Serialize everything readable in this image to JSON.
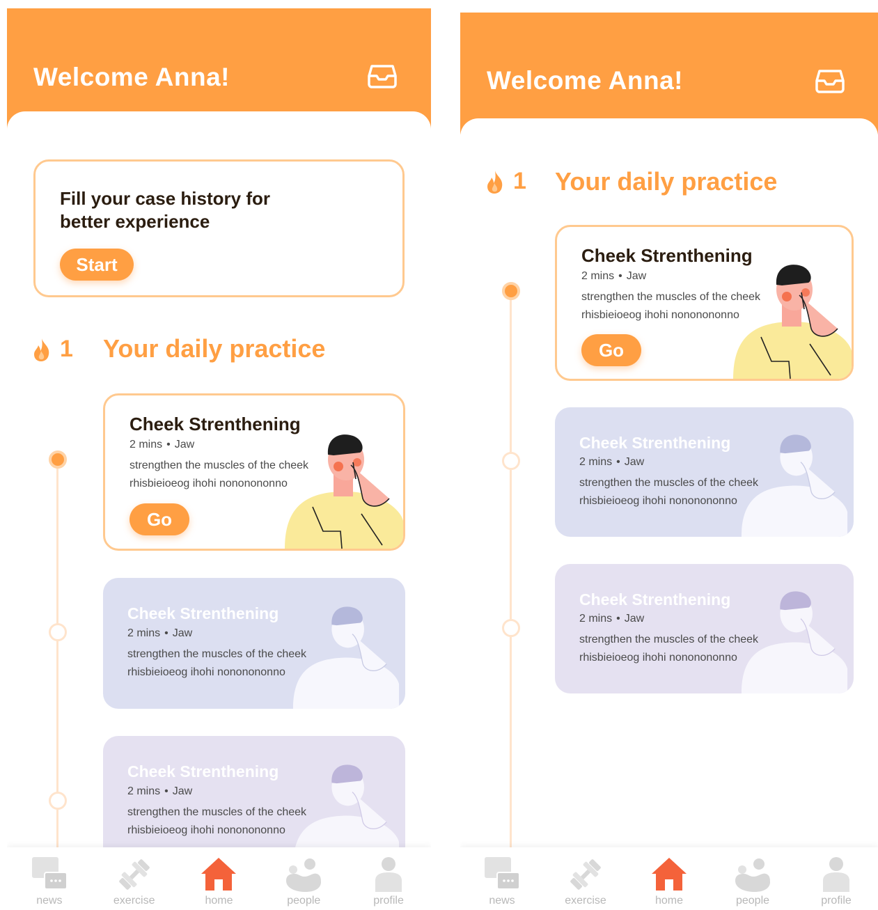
{
  "colors": {
    "accent": "#FF9F43",
    "accent_light": "#FFC98F",
    "card_locked_1": "#DCDFF1",
    "card_locked_2": "#E5E1F1",
    "home_active": "#F4623A",
    "tab_inactive": "#D8D8D8"
  },
  "header": {
    "title": "Welcome Anna!",
    "icon": "inbox-icon"
  },
  "case_history": {
    "text": "Fill your case history for better experience",
    "button_label": "Start"
  },
  "daily": {
    "streak_icon": "flame-icon",
    "streak_count": "1",
    "title": "Your daily practice"
  },
  "exercise": {
    "title": "Cheek Strenthening",
    "duration": "2 mins",
    "separator": "•",
    "area": "Jaw",
    "desc": "strengthen the muscles of the cheek rhisbieioeog ihohi nononononno",
    "button_label": "Go"
  },
  "tabs": [
    {
      "label": "news",
      "icon": "news-icon"
    },
    {
      "label": "exercise",
      "icon": "dumbbell-icon"
    },
    {
      "label": "home",
      "icon": "home-icon",
      "active": true
    },
    {
      "label": "people",
      "icon": "people-icon"
    },
    {
      "label": "profile",
      "icon": "profile-icon"
    }
  ]
}
